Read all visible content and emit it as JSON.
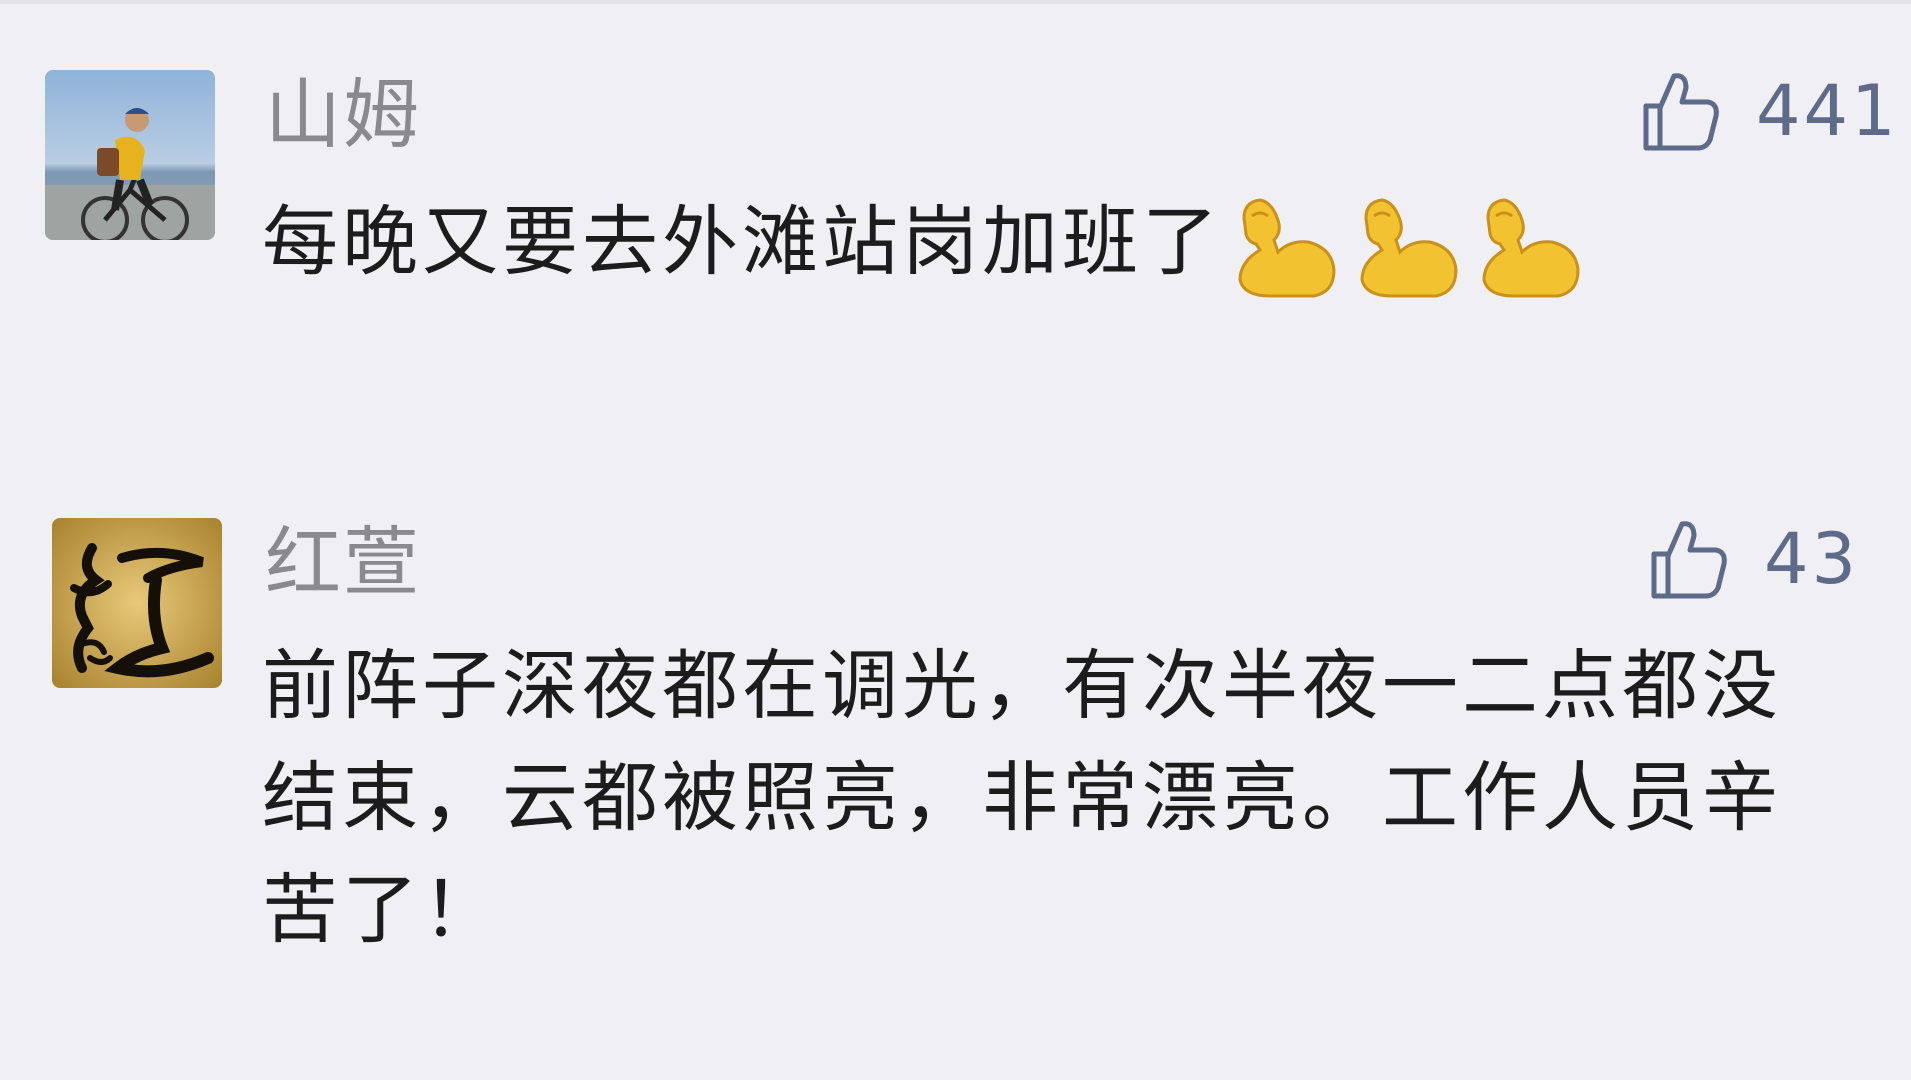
{
  "comments": [
    {
      "username": "山姆",
      "text": "每晚又要去外滩站岗加班了",
      "emoji": [
        "flexed-biceps",
        "flexed-biceps",
        "flexed-biceps"
      ],
      "likes": "441",
      "avatar": "cyclist-photo"
    },
    {
      "username": "红萱",
      "text": "前阵子深夜都在调光，有次半夜一二点都没结束，云都被照亮，非常漂亮。工作人员辛苦了！",
      "likes": "43",
      "avatar": "calligraphy-hong-character"
    }
  ],
  "colors": {
    "background": "#efeff4",
    "username": "#8a8a8e",
    "text": "#1c1c1c",
    "like": "#5d6a8a"
  }
}
